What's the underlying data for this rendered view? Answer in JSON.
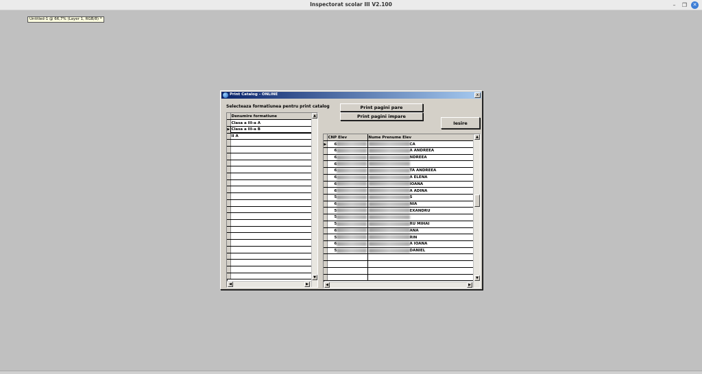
{
  "app": {
    "title": "Inspectorat scolar III V2.100"
  },
  "tooltip": "Untitled-1 @ 66,7% (Layer 1, RGB/8) *",
  "dialog": {
    "title": "Print Catalog - ONLINE",
    "close_glyph": "x",
    "prompt": "Selecteaza formatiunea pentru print catalog",
    "buttons": {
      "print_even": "Print pagini pare",
      "print_odd": "Print pagini impare",
      "exit": "Iesire"
    }
  },
  "formations_grid": {
    "header": "Denumire formatiune",
    "rows": [
      "Clasa a III-a A",
      "Clasa a III-a B",
      "II A"
    ],
    "selected_index": 1
  },
  "students_grid": {
    "headers": [
      "CNP Elev",
      "Nume Prenume Elev"
    ],
    "rows": [
      {
        "cnp": "6",
        "name": "CA"
      },
      {
        "cnp": "6",
        "name": "A ANDREEA"
      },
      {
        "cnp": "6",
        "name": "NDREEA"
      },
      {
        "cnp": "6",
        "name": ""
      },
      {
        "cnp": "6",
        "name": "TA ANDREEA"
      },
      {
        "cnp": "6",
        "name": "A ELENA"
      },
      {
        "cnp": "6",
        "name": "IOANA"
      },
      {
        "cnp": "6",
        "name": "A ADINA"
      },
      {
        "cnp": "5",
        "name": "S"
      },
      {
        "cnp": "6",
        "name": "NIA"
      },
      {
        "cnp": "5",
        "name": "EXANDRU"
      },
      {
        "cnp": "5",
        "name": ""
      },
      {
        "cnp": "5",
        "name": "RU MIHAI"
      },
      {
        "cnp": "6",
        "name": "ANA"
      },
      {
        "cnp": "5",
        "name": "RIN"
      },
      {
        "cnp": "6",
        "name": "A IOANA"
      },
      {
        "cnp": "5",
        "name": "DANIEL"
      }
    ]
  }
}
